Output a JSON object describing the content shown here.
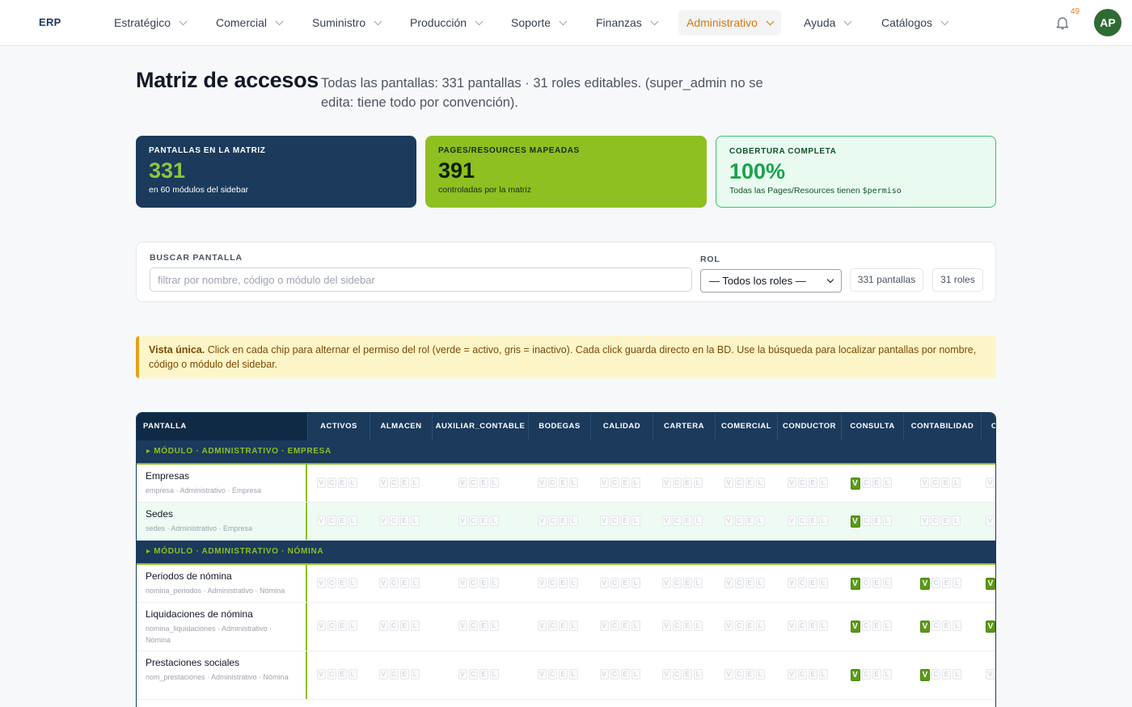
{
  "nav": {
    "brand": "ERP",
    "items": [
      {
        "label": "Estratégico"
      },
      {
        "label": "Comercial"
      },
      {
        "label": "Suministro"
      },
      {
        "label": "Producción"
      },
      {
        "label": "Soporte"
      },
      {
        "label": "Finanzas"
      },
      {
        "label": "Administrativo",
        "active": true
      },
      {
        "label": "Ayuda"
      },
      {
        "label": "Catálogos"
      }
    ],
    "notifications": "49",
    "avatar": "AP"
  },
  "header": {
    "title": "Matriz de accesos",
    "subtitle": "Todas las pantallas: 331 pantallas · 31 roles editables. (super_admin no se edita: tiene todo por convención)."
  },
  "stats": [
    {
      "label": "PANTALLAS EN LA MATRIZ",
      "value": "331",
      "desc": "en 60 módulos del sidebar"
    },
    {
      "label": "PAGES/RESOURCES MAPEADAS",
      "value": "391",
      "desc": "controladas por la matriz"
    },
    {
      "label": "COBERTURA COMPLETA",
      "value": "100%",
      "desc": "Todas las Pages/Resources tienen",
      "desc_code": "$permiso"
    }
  ],
  "filters": {
    "search_label": "BUSCAR PANTALLA",
    "search_placeholder": "filtrar por nombre, código o módulo del sidebar",
    "role_label": "ROL",
    "role_selected": "— Todos los roles —",
    "count_screens": "331 pantallas",
    "count_roles": "31 roles"
  },
  "banner": {
    "bold": "Vista única.",
    "text": " Click en cada chip para alternar el permiso del rol (verde = activo, gris = inactivo). Cada click guarda directo en la BD. Use la búsqueda para localizar pantallas por nombre, código o módulo del sidebar."
  },
  "table": {
    "first_header": "PANTALLA",
    "roles": [
      "ACTIVOS",
      "ALMACEN",
      "AUXILIAR_CONTABLE",
      "BODEGAS",
      "CALIDAD",
      "CARTERA",
      "COMERCIAL",
      "CONDUCTOR",
      "CONSULTA",
      "CONTABILIDAD",
      "CO"
    ],
    "chip_letters": [
      "V",
      "C",
      "E",
      "L"
    ],
    "modules": [
      {
        "label": "▸ MÓDULO · ADMINISTRATIVO · EMPRESA",
        "rows": [
          {
            "name": "Empresas",
            "sub": "empresa · Administrativo · Empresa",
            "active": [
              [],
              [],
              [],
              [],
              [],
              [],
              [],
              [],
              [
                "V"
              ],
              [],
              []
            ]
          },
          {
            "name": "Sedes",
            "sub": "sedes · Administrativo · Empresa",
            "highlight": true,
            "active": [
              [],
              [],
              [],
              [],
              [],
              [],
              [],
              [],
              [
                "V"
              ],
              [],
              []
            ]
          }
        ]
      },
      {
        "label": "▸ MÓDULO · ADMINISTRATIVO · NÓMINA",
        "rows": [
          {
            "name": "Periodos de nómina",
            "sub": "nomina_periodos · Administrativo · Nómina",
            "active": [
              [],
              [],
              [],
              [],
              [],
              [],
              [],
              [],
              [
                "V"
              ],
              [
                "V"
              ],
              [
                "V"
              ]
            ]
          },
          {
            "name": "Liquidaciones de nómina",
            "sub": "nomina_liquidaciones · Administrativo · Nómina",
            "active": [
              [],
              [],
              [],
              [],
              [],
              [],
              [],
              [],
              [
                "V"
              ],
              [
                "V"
              ],
              [
                "V"
              ]
            ]
          },
          {
            "name": "Prestaciones sociales",
            "sub": "nom_prestaciones · Administrativo · Nómina",
            "active": [
              [],
              [],
              [],
              [],
              [],
              [],
              [],
              [],
              [
                "V"
              ],
              [
                "V"
              ],
              []
            ]
          }
        ]
      }
    ]
  }
}
